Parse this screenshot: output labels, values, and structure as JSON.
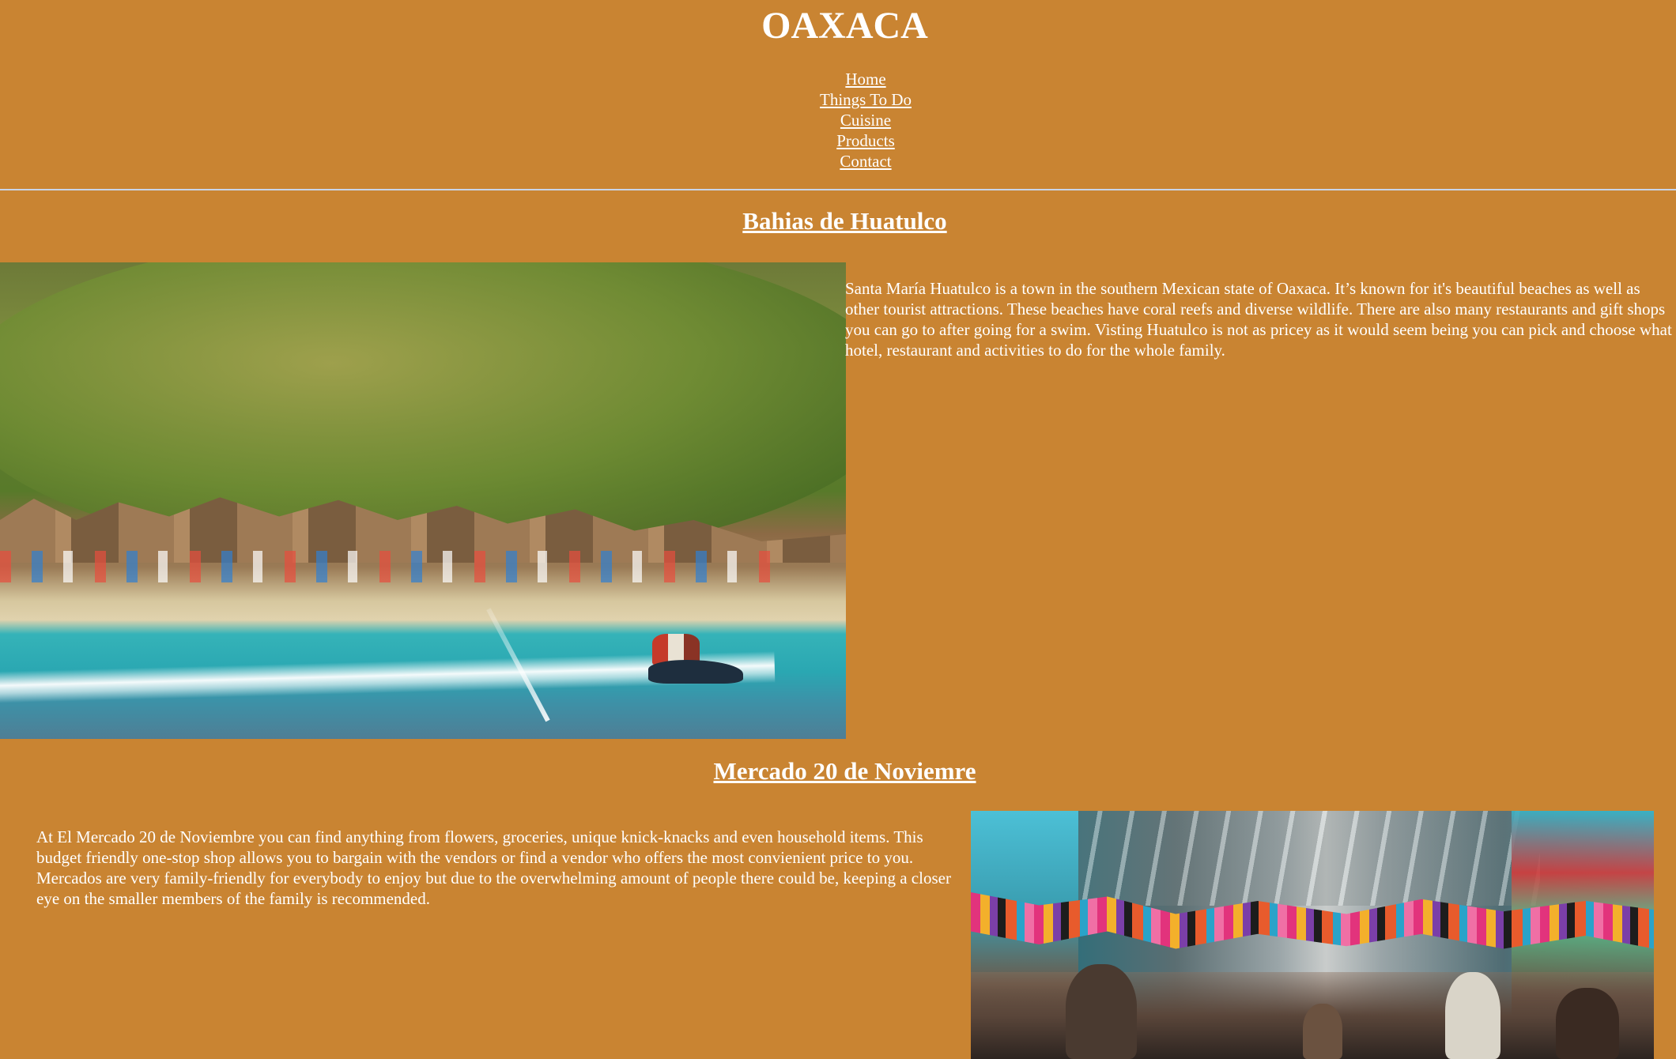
{
  "site": {
    "title": "OAXACA"
  },
  "nav": {
    "items": [
      {
        "label": "Home"
      },
      {
        "label": "Things To Do"
      },
      {
        "label": "Cuisine"
      },
      {
        "label": "Products"
      },
      {
        "label": "Contact"
      }
    ]
  },
  "sections": [
    {
      "title": "Bahias de Huatulco",
      "body": "Santa María Huatulco is a town in the southern Mexican state of Oaxaca. It’s known for it's beautiful beaches as well as other tourist attractions. These beaches have coral reefs and diverse wildlife. There are also many restaurants and gift shops you can go to after going for a swim. Visting Huatulco is not as pricey as it would seem being you can pick and choose what hotel, restaurant and activities to do for the whole family.",
      "image_alt": "beach-with-jetski"
    },
    {
      "title": "Mercado 20 de Noviemre",
      "body": "At El Mercado 20 de Noviembre you can find anything from flowers, groceries, unique knick-knacks and even household items. This budget friendly one-stop shop allows you to bargain with the vendors or find a vendor who offers the most convienient price to you. Mercados are very family-friendly for everybody to enjoy but due to the overwhelming amount of people there could be, keeping a closer eye on the smaller members of the family is recommended.",
      "image_alt": "market-interior"
    }
  ],
  "colors": {
    "background": "#c98432",
    "text": "#ffffff",
    "divider": "#c9d4e8"
  }
}
